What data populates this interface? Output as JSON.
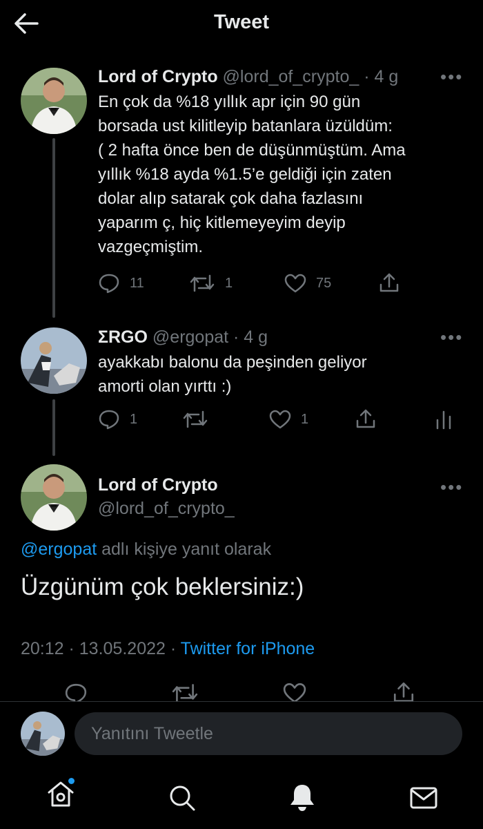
{
  "header": {
    "title": "Tweet"
  },
  "tweets": [
    {
      "name": "Lord of Crypto",
      "handle": "@lord_of_crypto_",
      "time": "· 4 g",
      "lines": [
        "En çok da %18 yıllık apr için 90 gün",
        "borsada ust kilitleyip batanlara üzüldüm:",
        "( 2 hafta önce ben de düşünmüştüm. Ama",
        "yıllık %18 ayda %1.5’e geldiği için zaten",
        "dolar alıp satarak çok daha fazlasını",
        "yaparım ç, hiç kitlemeyeyim deyip",
        "vazgeçmiştim."
      ],
      "replies": "11",
      "retweets": "1",
      "likes": "75"
    },
    {
      "name": "ΣRGO",
      "handle": "@ergopat",
      "time": "· 4 g",
      "lines": [
        "ayakkabı balonu da peşinden geliyor",
        "amorti olan yırttı :)"
      ],
      "replies": "1",
      "retweets": "",
      "likes": "1"
    }
  ],
  "main": {
    "name": "Lord of Crypto",
    "handle": "@lord_of_crypto_",
    "reply_to_handle": "@ergopat",
    "reply_to_suffix": " adlı kişiye yanıt olarak",
    "text": "Üzgünüm çok beklersiniz:)",
    "timestamp": "20:12 · 13.05.2022 · ",
    "source": "Twitter for iPhone"
  },
  "reply": {
    "placeholder": "Yanıtını Tweetle"
  },
  "colors": {
    "background": "#000000",
    "accent": "#1d9bf0",
    "muted": "#71767b",
    "text": "#e7e9ea"
  },
  "icons": [
    "back-arrow-icon",
    "more-icon",
    "reply-icon",
    "retweet-icon",
    "like-icon",
    "share-icon",
    "analytics-icon",
    "home-icon",
    "search-icon",
    "notifications-icon",
    "messages-icon"
  ]
}
